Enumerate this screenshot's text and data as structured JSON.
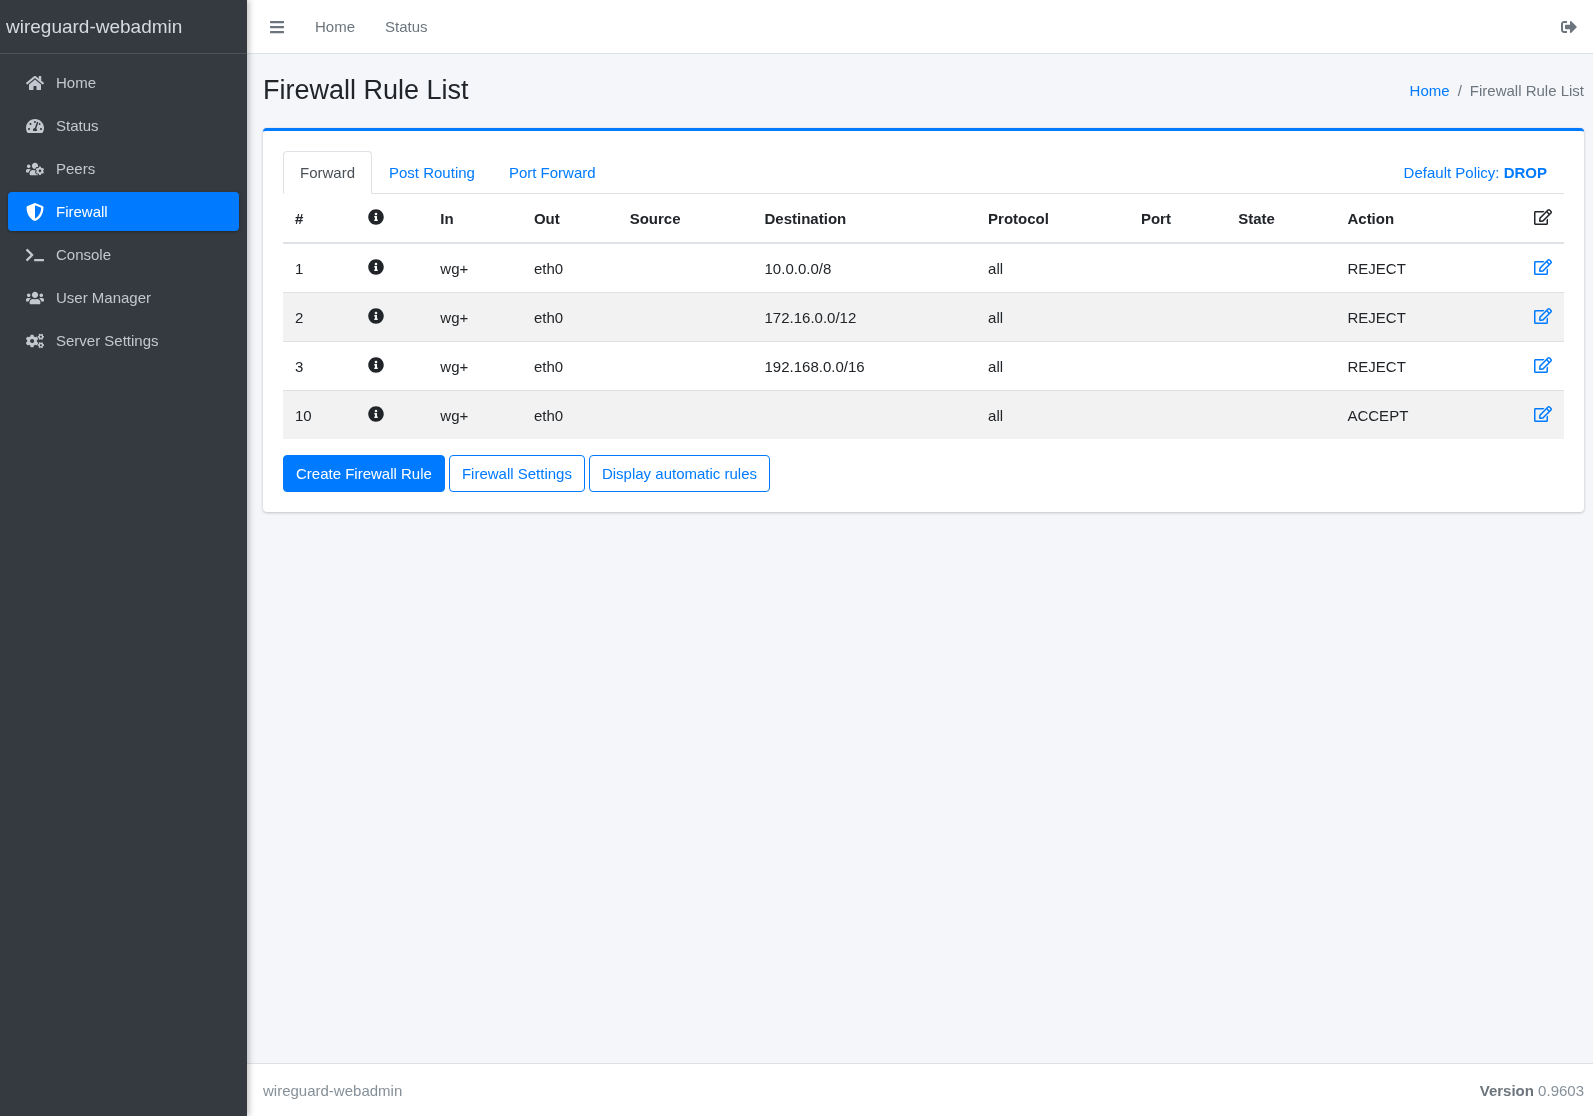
{
  "brand": "wireguard-webadmin",
  "sidebar": {
    "items": [
      {
        "label": "Home",
        "selected": false
      },
      {
        "label": "Status",
        "selected": false
      },
      {
        "label": "Peers",
        "selected": false
      },
      {
        "label": "Firewall",
        "selected": true
      },
      {
        "label": "Console",
        "selected": false
      },
      {
        "label": "User Manager",
        "selected": false
      },
      {
        "label": "Server Settings",
        "selected": false
      }
    ]
  },
  "topbar": {
    "links": [
      "Home",
      "Status"
    ]
  },
  "page_title": "Firewall Rule List",
  "breadcrumb": {
    "link": "Home",
    "separator": "/",
    "current": "Firewall Rule List"
  },
  "tabs": [
    {
      "label": "Forward",
      "selected": true
    },
    {
      "label": "Post Routing",
      "selected": false
    },
    {
      "label": "Port Forward",
      "selected": false
    }
  ],
  "default_policy": "Default Policy: **DROP**",
  "table": {
    "columns": [
      "#",
      "In",
      "Out",
      "Source",
      "Destination",
      "Protocol",
      "Port",
      "State",
      "Action"
    ],
    "rows": [
      {
        "number": "1",
        "in": "wg+",
        "out": "eth0",
        "destination": "10.0.0.0/8",
        "protocol": "all",
        "action": "REJECT"
      },
      {
        "number": "2",
        "in": "wg+",
        "out": "eth0",
        "destination": "172.16.0.0/12",
        "protocol": "all",
        "action": "REJECT"
      },
      {
        "number": "3",
        "in": "wg+",
        "out": "eth0",
        "destination": "192.168.0.0/16",
        "protocol": "all",
        "action": "REJECT"
      },
      {
        "number": "10",
        "in": "wg+",
        "out": "eth0",
        "protocol": "all",
        "action": "ACCEPT"
      }
    ]
  },
  "buttons": [
    {
      "label": "Create Firewall Rule",
      "kind": "primary"
    },
    {
      "label": "Firewall Settings",
      "kind": "outline"
    },
    {
      "label": "Display automatic rules",
      "kind": "outline"
    }
  ],
  "footer": {
    "left": "wireguard-webadmin",
    "right": "**Version** 0.9603"
  }
}
